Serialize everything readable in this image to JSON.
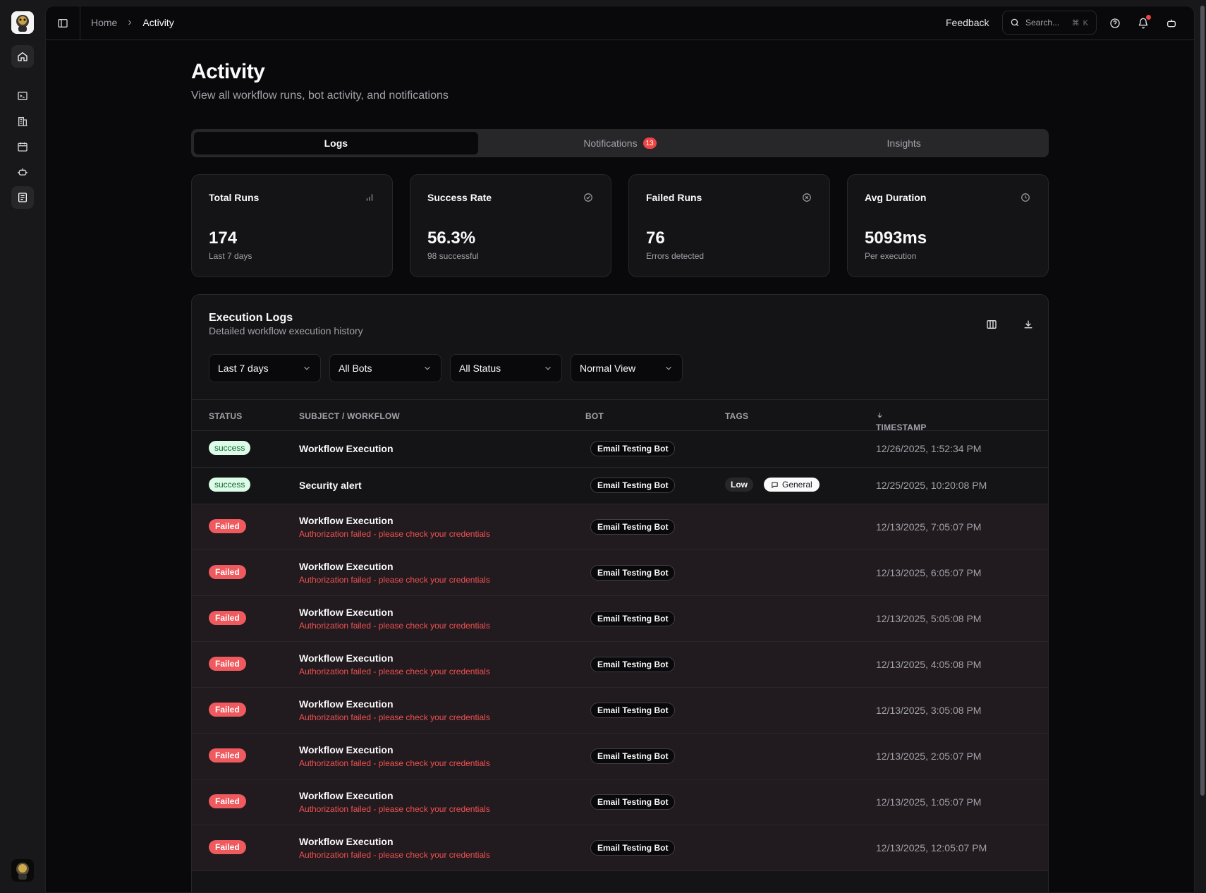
{
  "breadcrumb": {
    "home": "Home",
    "current": "Activity"
  },
  "topbar": {
    "feedback": "Feedback",
    "search_placeholder": "Search...",
    "search_shortcut": "⌘ K"
  },
  "page": {
    "title": "Activity",
    "subtitle": "View all workflow runs, bot activity, and notifications"
  },
  "tabs": [
    {
      "label": "Logs",
      "active": true
    },
    {
      "label": "Notifications",
      "badge": "13",
      "active": false
    },
    {
      "label": "Insights",
      "active": false
    }
  ],
  "stats": [
    {
      "label": "Total Runs",
      "value": "174",
      "caption": "Last 7 days",
      "icon": "bar-chart-icon"
    },
    {
      "label": "Success Rate",
      "value": "56.3%",
      "caption": "98 successful",
      "icon": "check-circle-icon"
    },
    {
      "label": "Failed Runs",
      "value": "76",
      "caption": "Errors detected",
      "icon": "x-circle-icon"
    },
    {
      "label": "Avg Duration",
      "value": "5093ms",
      "caption": "Per execution",
      "icon": "clock-icon"
    }
  ],
  "logs": {
    "title": "Execution Logs",
    "subtitle": "Detailed workflow execution history",
    "filters": [
      "Last 7 days",
      "All Bots",
      "All Status",
      "Normal View"
    ],
    "columns": {
      "status": "STATUS",
      "subject": "SUBJECT / WORKFLOW",
      "bot": "BOT",
      "tags": "TAGS",
      "timestamp": "TIMESTAMP"
    },
    "rows": [
      {
        "status": "success",
        "subject": "Workflow Execution",
        "error": "",
        "bot": "Email Testing Bot",
        "tags": [],
        "timestamp": "12/26/2025, 1:52:34 PM"
      },
      {
        "status": "success",
        "subject": "Security alert",
        "error": "",
        "bot": "Email Testing Bot",
        "tags": [
          "Low",
          "General"
        ],
        "timestamp": "12/25/2025, 10:20:08 PM"
      },
      {
        "status": "Failed",
        "subject": "Workflow Execution",
        "error": "Authorization failed - please check your credentials",
        "bot": "Email Testing Bot",
        "tags": [],
        "timestamp": "12/13/2025, 7:05:07 PM"
      },
      {
        "status": "Failed",
        "subject": "Workflow Execution",
        "error": "Authorization failed - please check your credentials",
        "bot": "Email Testing Bot",
        "tags": [],
        "timestamp": "12/13/2025, 6:05:07 PM"
      },
      {
        "status": "Failed",
        "subject": "Workflow Execution",
        "error": "Authorization failed - please check your credentials",
        "bot": "Email Testing Bot",
        "tags": [],
        "timestamp": "12/13/2025, 5:05:08 PM"
      },
      {
        "status": "Failed",
        "subject": "Workflow Execution",
        "error": "Authorization failed - please check your credentials",
        "bot": "Email Testing Bot",
        "tags": [],
        "timestamp": "12/13/2025, 4:05:08 PM"
      },
      {
        "status": "Failed",
        "subject": "Workflow Execution",
        "error": "Authorization failed - please check your credentials",
        "bot": "Email Testing Bot",
        "tags": [],
        "timestamp": "12/13/2025, 3:05:08 PM"
      },
      {
        "status": "Failed",
        "subject": "Workflow Execution",
        "error": "Authorization failed - please check your credentials",
        "bot": "Email Testing Bot",
        "tags": [],
        "timestamp": "12/13/2025, 2:05:07 PM"
      },
      {
        "status": "Failed",
        "subject": "Workflow Execution",
        "error": "Authorization failed - please check your credentials",
        "bot": "Email Testing Bot",
        "tags": [],
        "timestamp": "12/13/2025, 1:05:07 PM"
      },
      {
        "status": "Failed",
        "subject": "Workflow Execution",
        "error": "Authorization failed - please check your credentials",
        "bot": "Email Testing Bot",
        "tags": [],
        "timestamp": "12/13/2025, 12:05:07 PM"
      }
    ]
  },
  "colors": {
    "background": "#09090b",
    "failed_row": "#211a1e",
    "failed_pill": "#ef5a5f",
    "success_pill": "#dcfce7",
    "error_text": "#f05252",
    "notification_badge": "#ef4444"
  }
}
